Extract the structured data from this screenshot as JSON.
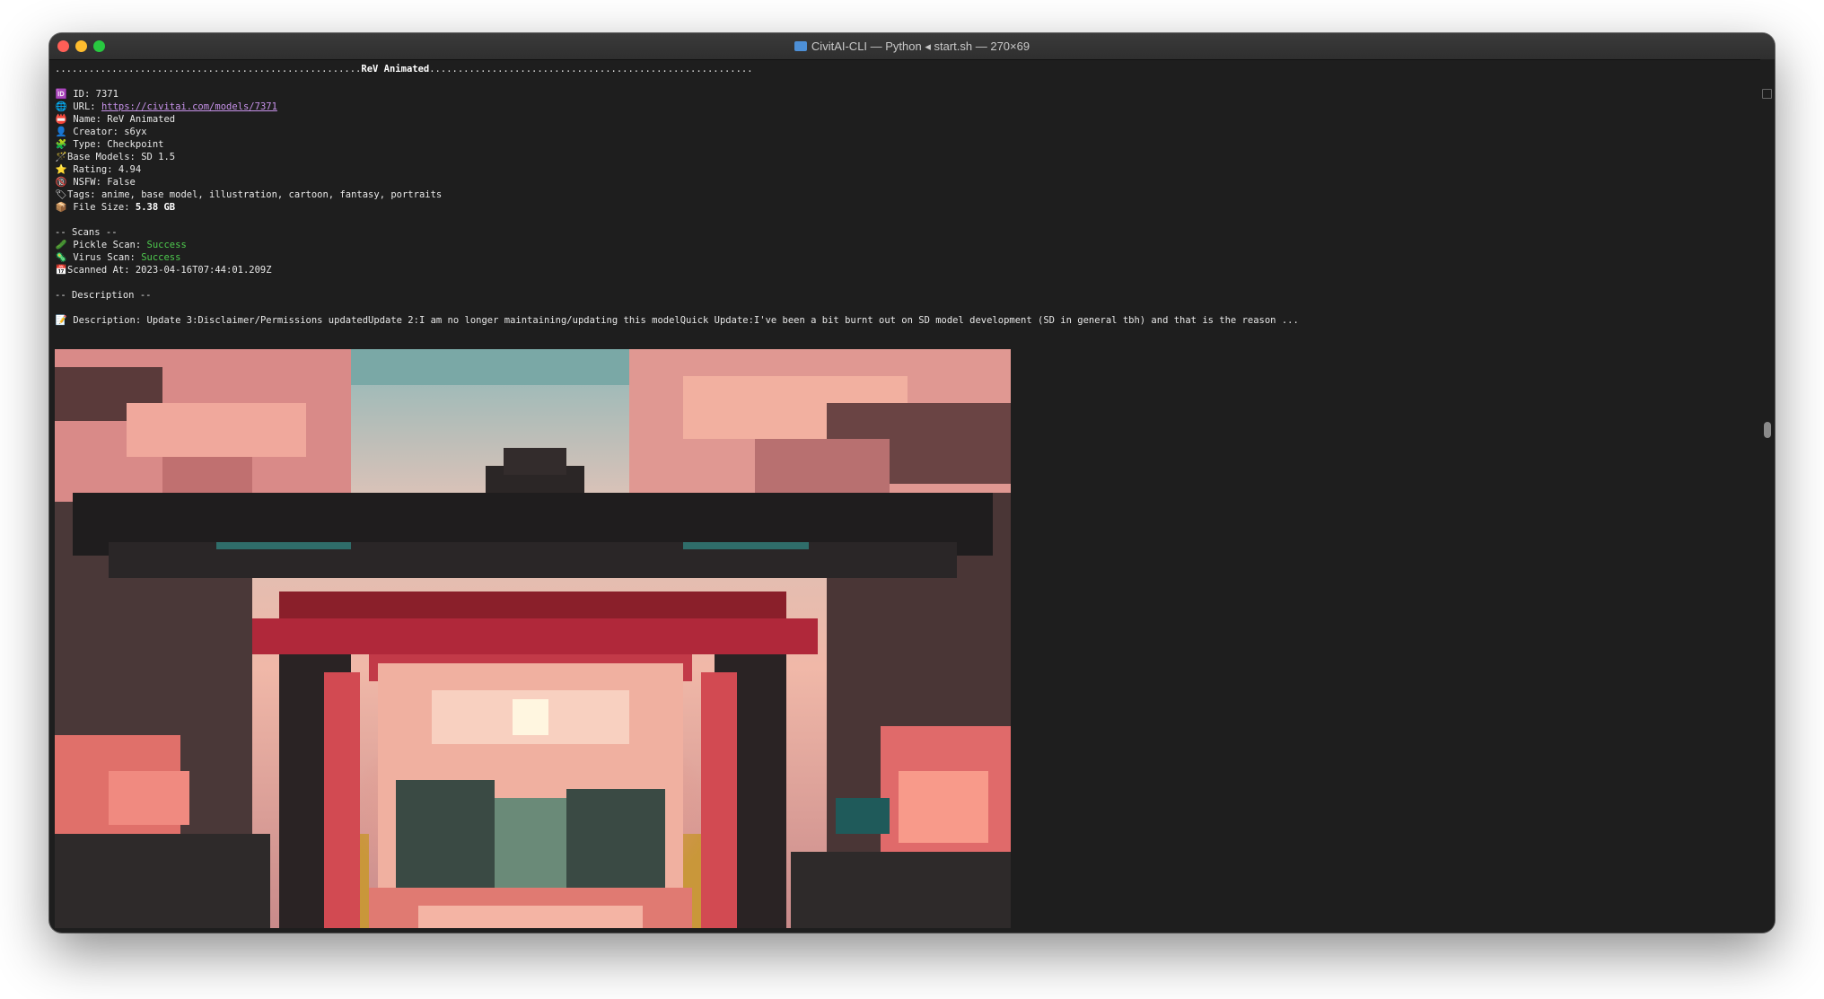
{
  "window": {
    "title": "CivitAI-CLI — Python ◂ start.sh — 270×69"
  },
  "terminal": {
    "header_dots_left": "......................................................",
    "header_title": "ReV Animated",
    "header_dots_right": ".........................................................",
    "lines": {
      "id": {
        "icon": "🆔",
        "label": "ID: ",
        "value": "7371"
      },
      "url": {
        "icon": "🌐",
        "label": "URL: ",
        "value": "https://civitai.com/models/7371"
      },
      "name": {
        "icon": "📛",
        "label": "Name: ",
        "value": "ReV Animated"
      },
      "creator": {
        "icon": "👤",
        "label": "Creator: ",
        "value": "s6yx"
      },
      "type": {
        "icon": "🧩",
        "label": "Type: ",
        "value": "Checkpoint"
      },
      "base_models": {
        "icon": "🪄",
        "label": "Base Models: ",
        "value": "SD 1.5"
      },
      "rating": {
        "icon": "⭐",
        "label": "Rating: ",
        "value": "4.94"
      },
      "nsfw": {
        "icon": "🔞",
        "label": "NSFW: ",
        "value": "False"
      },
      "tags": {
        "icon": "🏷",
        "label": "Tags: ",
        "value": "anime, base model, illustration, cartoon, fantasy, portraits"
      },
      "file_size": {
        "icon": "📦",
        "label": "File Size: ",
        "value": "5.38 GB"
      }
    },
    "scans_header": "-- Scans --",
    "scans": {
      "pickle": {
        "icon": "🥒",
        "label": "Pickle Scan: ",
        "value": "Success"
      },
      "virus": {
        "icon": "🦠",
        "label": "Virus Scan: ",
        "value": "Success"
      },
      "scanned_at": {
        "icon": "📅",
        "label": "Scanned At: ",
        "value": "2023-04-16T07:44:01.209Z"
      }
    },
    "description_header": "-- Description --",
    "description": {
      "icon": "📝",
      "label": "Description: ",
      "value": "Update 3:Disclaimer/Permissions updatedUpdate 2:I am no longer maintaining/updating this modelQuick Update:I've been a bit burnt out on SD model development (SD in general tbh) and that is the reason ..."
    }
  },
  "colors": {
    "background": "#1e1e1e",
    "text": "#e8e8e8",
    "link": "#c792ea",
    "success": "#4ec94e"
  }
}
